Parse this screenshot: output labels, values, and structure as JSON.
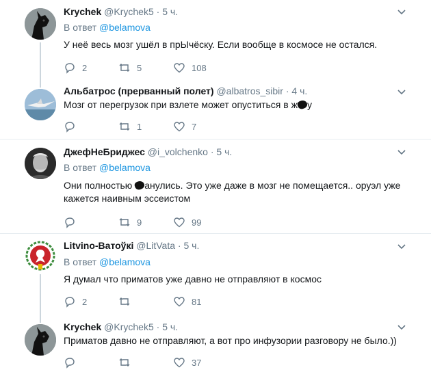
{
  "tweets": [
    {
      "name": "Krychek",
      "handle": "@Krychek5",
      "dot": "·",
      "time": "5 ч.",
      "reply_prefix": "В ответ",
      "reply_to": "@belamova",
      "text": "У неё весь мозг ушёл в прЫчёску. Если вообще в космосе не остался.",
      "replies": "2",
      "retweets": "5",
      "likes": "108",
      "avatar": "black-dog"
    },
    {
      "name": "Альбатрос (прерванный полет)",
      "handle": "@albatros_sibir",
      "dot": "·",
      "time": "4 ч.",
      "text_a": "Мозг от перегрузок при взлете может опуститься в ж",
      "text_b": "у",
      "replies": "",
      "retweets": "1",
      "likes": "7",
      "avatar": "albatross"
    },
    {
      "name": "ДжефНеБриджес",
      "handle": "@i_volchenko",
      "dot": "·",
      "time": "5 ч.",
      "reply_prefix": "В ответ",
      "reply_to": "@belamova",
      "text_a": "Они полностью ",
      "text_b": "анулись.  Это уже даже в мозг не помещается.. оруэл уже кажется наивным эссеистом",
      "replies": "",
      "retweets": "9",
      "likes": "99",
      "avatar": "bw-portrait"
    },
    {
      "name": "Litvino-Ватоўкі",
      "handle": "@LitVata",
      "dot": "·",
      "time": "5 ч.",
      "reply_prefix": "В ответ",
      "reply_to": "@belamova",
      "text": "Я думал что приматов уже давно не отправляют в космос",
      "replies": "2",
      "retweets": "",
      "likes": "81",
      "avatar": "emblem"
    },
    {
      "name": "Krychek",
      "handle": "@Krychek5",
      "dot": "·",
      "time": "5 ч.",
      "text": "Приматов давно не отправляют, а вот про инфузории разговору не было.))",
      "replies": "",
      "retweets": "",
      "likes": "37",
      "avatar": "black-dog"
    }
  ],
  "colors": {
    "link": "#1b95e0",
    "meta": "#657786",
    "thread": "#ccd6dd",
    "separator": "#e6ecf0"
  }
}
